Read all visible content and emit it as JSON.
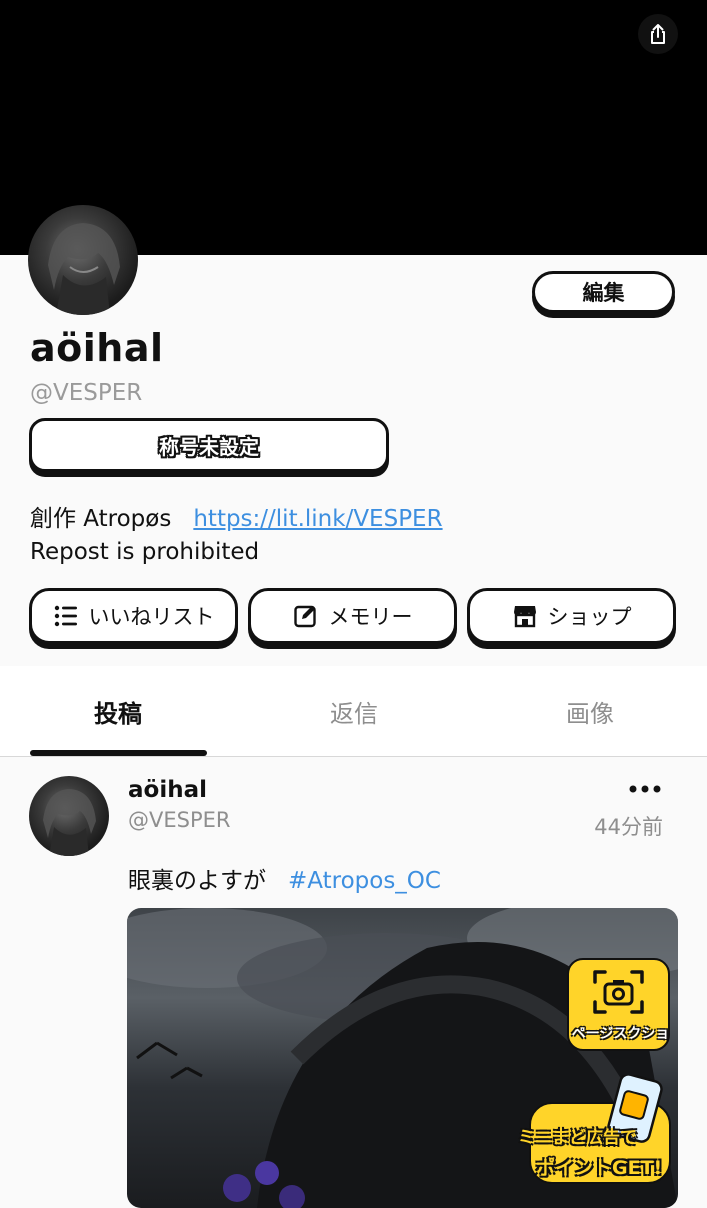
{
  "profile": {
    "display_name": "aöihal",
    "handle": "@VESPER",
    "edit_label": "編集",
    "title_badge": "称号未設定",
    "bio_line1": "創作 Atropøs",
    "bio_link": "https://lit.link/VESPER",
    "bio_line2": "Repost is prohibited"
  },
  "actions": [
    {
      "label": "いいねリスト",
      "icon": "list-icon"
    },
    {
      "label": "メモリー",
      "icon": "memo-edit-icon"
    },
    {
      "label": "ショップ",
      "icon": "shop-icon"
    }
  ],
  "tabs": [
    {
      "label": "投稿",
      "active": true
    },
    {
      "label": "返信",
      "active": false
    },
    {
      "label": "画像",
      "active": false
    }
  ],
  "post": {
    "name": "aöihal",
    "handle": "@VESPER",
    "time": "44分前",
    "text": "眼裏のよすが",
    "hashtag": "#Atropos_OC"
  },
  "overlays": {
    "screenshot_label": "ページスクショ",
    "ad_line1": "ミニまど広告で",
    "ad_line2": "ポイントGET!"
  },
  "colors": {
    "accent_link": "#3d8fe0",
    "badge_yellow": "#ffd429",
    "banner": "#000000"
  }
}
